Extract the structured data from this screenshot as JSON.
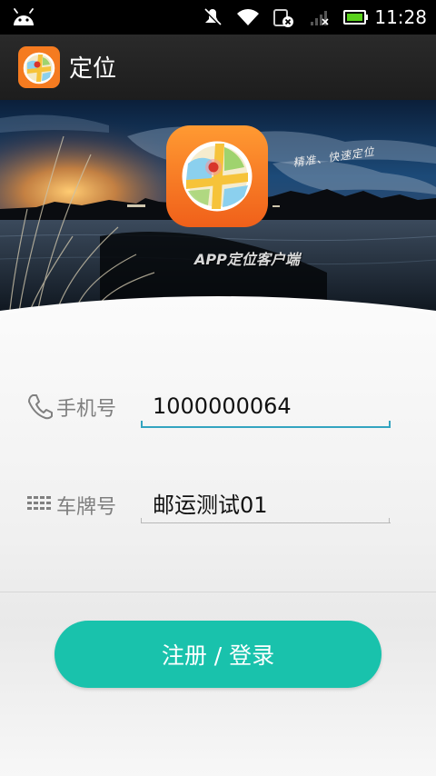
{
  "status_bar": {
    "time": "11:28",
    "icons": [
      "android-icon",
      "mute-icon",
      "wifi-icon",
      "sim-icon",
      "signal-icon",
      "battery-icon"
    ]
  },
  "action_bar": {
    "title": "定位",
    "icon": "map-pin-app-icon"
  },
  "banner": {
    "tagline": "精准、快速定位",
    "subtitle": "APP定位客户端",
    "logo_icon": "map-pin-logo-icon"
  },
  "form": {
    "phone": {
      "label": "手机号",
      "icon": "phone-icon",
      "value": "1000000064"
    },
    "plate": {
      "label": "车牌号",
      "icon": "plate-icon",
      "value": "邮运测试01"
    },
    "login_button": "注册 / 登录"
  },
  "colors": {
    "accent": "#19c2ac",
    "input_focus": "#33a4c0",
    "logo_orange": "#f57b20"
  }
}
